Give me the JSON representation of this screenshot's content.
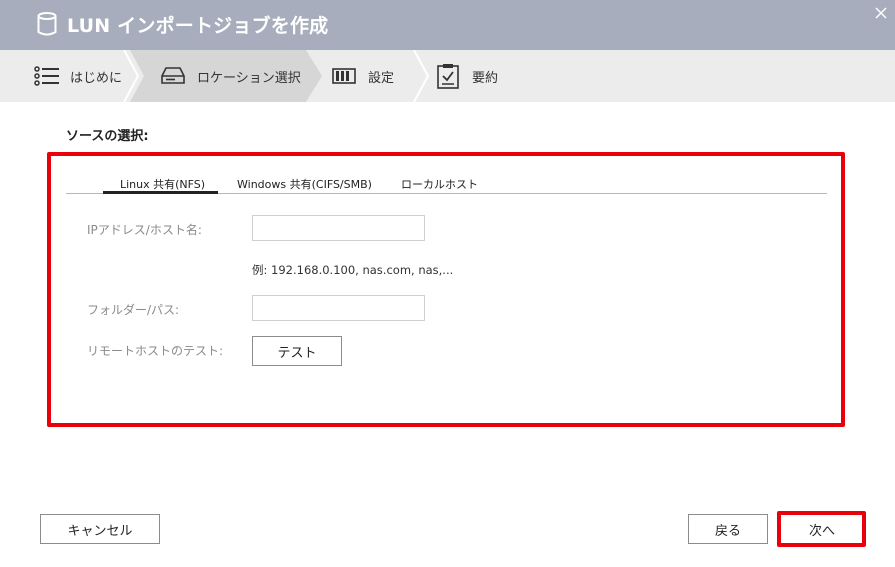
{
  "window": {
    "title": "LUN インポートジョブを作成",
    "title_icon": "database-icon",
    "close_icon": "close-icon"
  },
  "steps": [
    {
      "label": "はじめに",
      "icon": "list-icon",
      "active": false
    },
    {
      "label": "ロケーション選択",
      "icon": "drive-icon",
      "active": true
    },
    {
      "label": "設定",
      "icon": "settings-bar-icon",
      "active": false
    },
    {
      "label": "要約",
      "icon": "clipboard-check-icon",
      "active": false
    }
  ],
  "section": {
    "title": "ソースの選択:"
  },
  "tabs": [
    {
      "label": "Linux 共有(NFS)",
      "active": true
    },
    {
      "label": "Windows 共有(CIFS/SMB)",
      "active": false
    },
    {
      "label": "ローカルホスト",
      "active": false
    }
  ],
  "form": {
    "ip_label": "IPアドレス/ホスト名:",
    "ip_value": "",
    "ip_hint": "例: 192.168.0.100, nas.com, nas,...",
    "folder_label": "フォルダー/パス:",
    "folder_value": "",
    "remote_test_label": "リモートホストのテスト:",
    "test_button": "テスト"
  },
  "footer": {
    "cancel": "キャンセル",
    "back": "戻る",
    "next": "次へ"
  },
  "colors": {
    "titlebar": "#a8adbd",
    "highlight": "#e8000b"
  }
}
